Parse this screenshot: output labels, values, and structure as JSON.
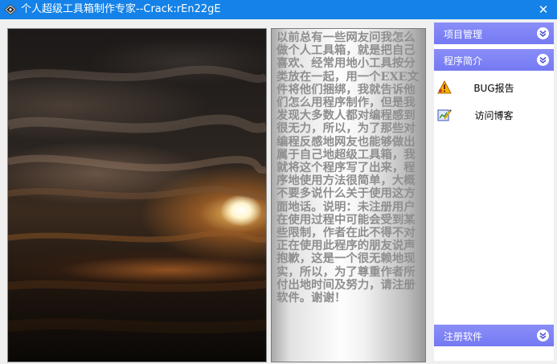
{
  "window": {
    "title": "个人超级工具箱制作专家--Crack:rEn22gE",
    "close_glyph": "✕"
  },
  "intro": {
    "text": "以前总有一些网友问我怎么做个人工具箱，就是把自己喜欢、经常用地小工具按分类放在一起，用一个EXE文件将他们捆绑，我就告诉他们怎么用程序制作，但是我发现大多数人都对编程感到很无力，所以，为了那些对编程反感地网友也能够做出属于自己地超级工具箱，我就将这个程序写了出来，程序地使用方法很简单，大概不要多说什么关于使用这方面地话。说明：未注册用户在使用过程中可能会受到某些限制，作者在此不得不对正在使用此程序的朋友说声抱歉，这是一个很无赖地现实，所以，为了尊重作者所付出地时间及努力，请注册软件。谢谢！"
  },
  "sidebar": {
    "sections": [
      {
        "label": "项目管理",
        "icon": "chevron-down-icon"
      },
      {
        "label": "程序简介",
        "icon": "chevron-down-icon"
      },
      {
        "label": "注册软件",
        "icon": "chevron-down-icon"
      }
    ],
    "items": [
      {
        "label": "BUG报告",
        "icon": "warning-bug-icon"
      },
      {
        "label": "访问博客",
        "icon": "pencil-chart-icon"
      }
    ]
  },
  "colors": {
    "titlebar": "#1482e8",
    "sidebar_header": "#7c80f4",
    "text_fg": "#8e8e8e"
  }
}
